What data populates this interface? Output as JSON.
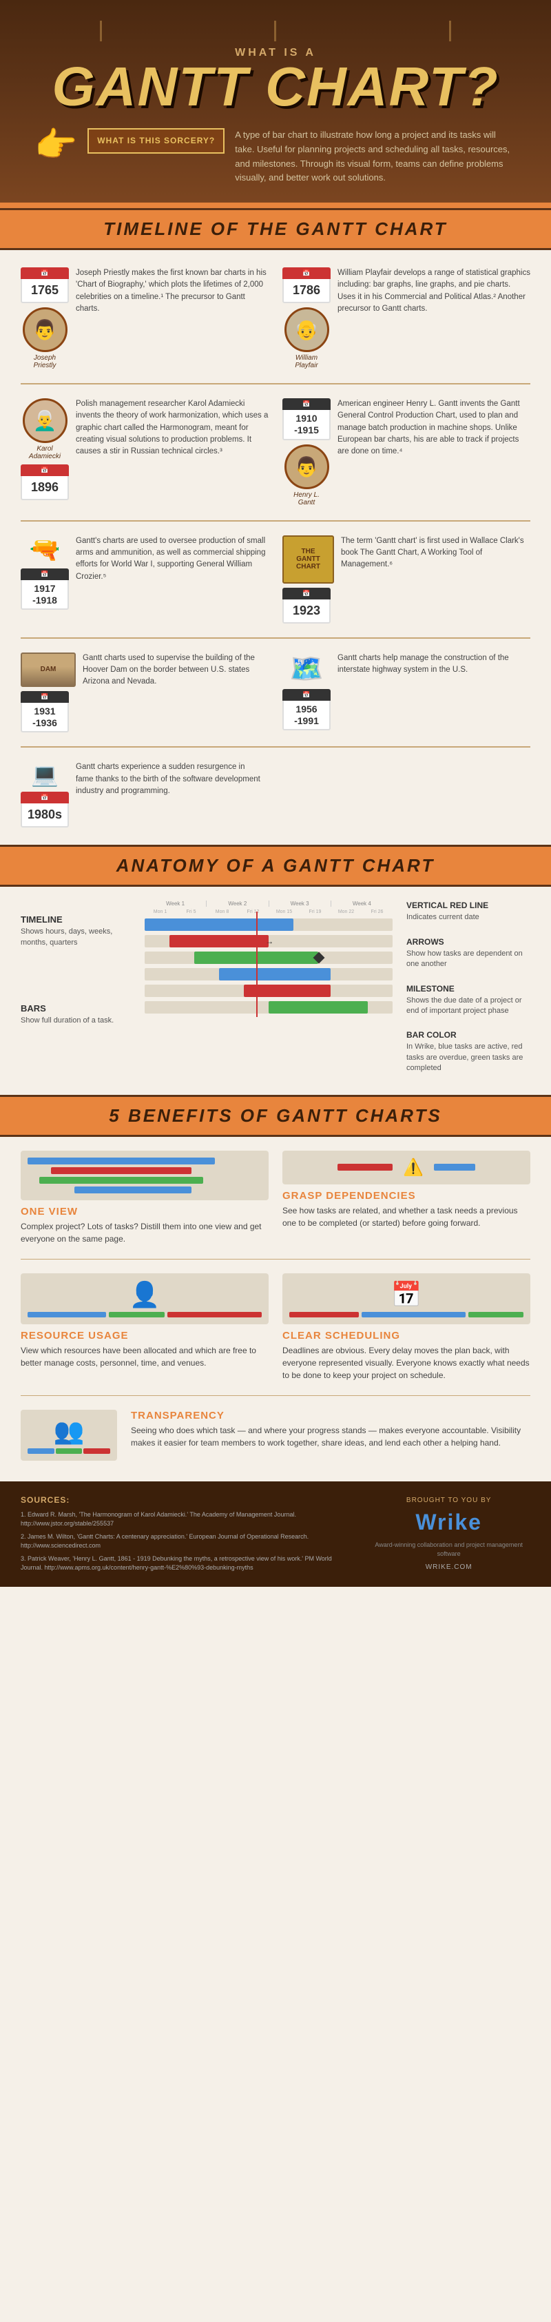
{
  "header": {
    "top_label": "What is a",
    "main_title": "Gantt Chart?",
    "sorcery_label": "What is this sorcery?",
    "sorcery_desc": "A type of bar chart to illustrate how long a project and its tasks will take. Useful for planning projects and scheduling all tasks, resources, and milestones. Through its visual form, teams can define problems visually, and better work out solutions."
  },
  "timeline": {
    "section_title": "Timeline of the Gantt Chart",
    "entries": [
      {
        "side": "left",
        "date": "1765",
        "name": "Joseph Priestly",
        "text": "Joseph Priestly makes the first known bar charts in his 'Chart of Biography,' which plots the lifetimes of 2,000 celebrities on a timeline.¹ The precursor to Gantt charts."
      },
      {
        "side": "right",
        "date": "1786",
        "name": "William Playfair",
        "text": "William Playfair develops a range of statistical graphics including: bar graphs, line graphs, and pie charts. Uses it in his Commercial and Political Atlas.² Another precursor to Gantt charts."
      },
      {
        "side": "left",
        "date": "1896",
        "name": "Karol Adamiecki",
        "text": "Polish management researcher Karol Adamiecki invents the theory of work harmonization, which uses a graphic chart called the Harmonogram, meant for creating visual solutions to production problems. It causes a stir in Russian technical circles.³"
      },
      {
        "side": "right",
        "date": "1910-1915",
        "name": "Henry L. Gantt",
        "text": "American engineer Henry L. Gantt invents the Gantt General Control Production Chart, used to plan and manage batch production in machine shops. Unlike European bar charts, his are able to track if projects are done on time.⁴"
      },
      {
        "side": "left",
        "date": "1917-1918",
        "text": "Gantt's charts are used to oversee production of small arms and ammunition, as well as commercial shipping efforts for World War I, supporting General William Crozier.⁵"
      },
      {
        "side": "right",
        "date": "1923",
        "text": "The term 'Gantt chart' is first used in Wallace Clark's book The Gantt Chart, A Working Tool of Management.⁶"
      },
      {
        "side": "left",
        "date": "1931-1936",
        "text": "Gantt charts used to supervise the building of the Hoover Dam on the border between U.S. states Arizona and Nevada."
      },
      {
        "side": "right",
        "date": "1956-1991",
        "text": "Gantt charts help manage the construction of the interstate highway system in the U.S."
      },
      {
        "side": "left",
        "date": "1980s",
        "text": "Gantt charts experience a sudden resurgence in fame thanks to the birth of the software development industry and programming."
      }
    ]
  },
  "anatomy": {
    "section_title": "Anatomy of a Gantt Chart",
    "labels": {
      "timeline": {
        "title": "Timeline",
        "desc": "Shows hours, days, weeks, months, quarters"
      },
      "bars": {
        "title": "Bars",
        "desc": "Show full duration of a task."
      },
      "vertical_red_line": {
        "title": "Vertical Red Line",
        "desc": "Indicates current date"
      },
      "arrows": {
        "title": "Arrows",
        "desc": "Show how tasks are dependent on one another"
      },
      "milestone": {
        "title": "Milestone",
        "desc": "Shows the due date of a project or end of important project phase"
      },
      "bar_color": {
        "title": "Bar Color",
        "desc": "In Wrike, blue tasks are active, red tasks are overdue, green tasks are completed"
      }
    }
  },
  "benefits": {
    "section_title": "5 Benefits of Gantt Charts",
    "items": [
      {
        "id": "one-view",
        "title": "One View",
        "desc": "Complex project? Lots of tasks? Distill them into one view and get everyone on the same page."
      },
      {
        "id": "grasp-dependencies",
        "title": "Grasp Dependencies",
        "desc": "See how tasks are related, and whether a task needs a previous one to be completed (or started) before going forward."
      },
      {
        "id": "resource-usage",
        "title": "Resource Usage",
        "desc": "View which resources have been allocated and which are free to better manage costs, personnel, time, and venues."
      },
      {
        "id": "clear-scheduling",
        "title": "Clear Scheduling",
        "desc": "Deadlines are obvious. Every delay moves the plan back, with everyone represented visually. Everyone knows exactly what needs to be done to keep your project on schedule."
      },
      {
        "id": "transparency",
        "title": "Transparency",
        "desc": "Seeing who does which task — and where your progress stands — makes everyone accountable. Visibility makes it easier for team members to work together, share ideas, and lend each other a helping hand."
      }
    ]
  },
  "footer": {
    "sources_title": "Sources:",
    "sources": [
      "1. Edward R. Marsh, 'The Harmonogram of Karol Adamiecki.' The Academy of Management Journal. http://www.jstor.org/stable/255537",
      "2. James M. Wilton, 'Gantt Charts: A centenary appreciation.' European Journal of Operational Research. http://www.sciencedirect.com",
      "3. Patrick Weaver, 'Henry L. Gantt, 1861 - 1919 Debunking the myths, a retrospective view of his work.' PM World Journal. http://www.apms.org.uk/content/henry-gantt-%E2%80%93-debunking-myths"
    ],
    "brought_by": "Brought to you by",
    "brand": "Wrike",
    "tagline": "Award-winning collaboration and project management software",
    "url": "WRIKE.COM"
  },
  "colors": {
    "orange": "#E8853D",
    "dark_brown": "#3B1F0A",
    "red": "#cc3333",
    "blue": "#4A90D9",
    "green": "#4CAF50",
    "gold": "#e8c060",
    "bg_cream": "#f5f0e8"
  }
}
